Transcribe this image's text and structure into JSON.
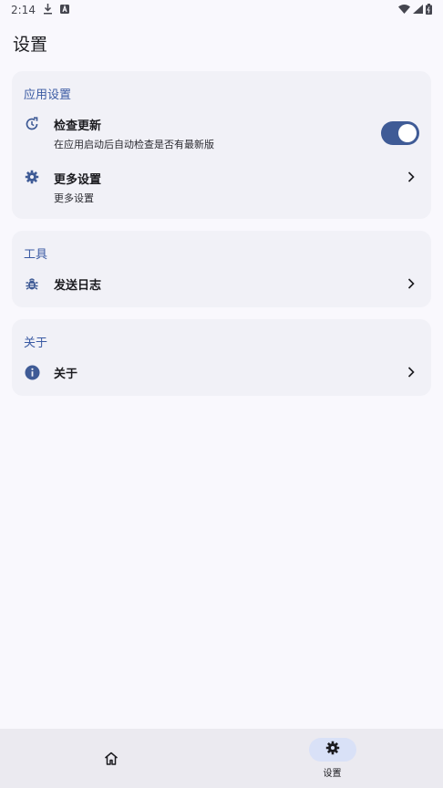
{
  "status": {
    "time": "2:14"
  },
  "page": {
    "title": "设置"
  },
  "sections": {
    "app": {
      "title": "应用设置",
      "check_update": {
        "title": "检查更新",
        "subtitle": "在应用启动后自动检查是否有最新版",
        "toggle_on": true
      },
      "more_settings": {
        "title": "更多设置",
        "subtitle": "更多设置"
      }
    },
    "tools": {
      "title": "工具",
      "send_log": {
        "title": "发送日志"
      }
    },
    "about": {
      "title": "关于",
      "about_item": {
        "title": "关于"
      }
    }
  },
  "nav": {
    "home": {
      "icon": "home-icon"
    },
    "settings": {
      "label": "设置",
      "icon": "gear-icon",
      "active": true
    }
  },
  "colors": {
    "accent": "#3f5b96",
    "section_title": "#3a5aa3",
    "card_bg": "#f1f1f7",
    "page_bg": "#f9f8fd"
  }
}
